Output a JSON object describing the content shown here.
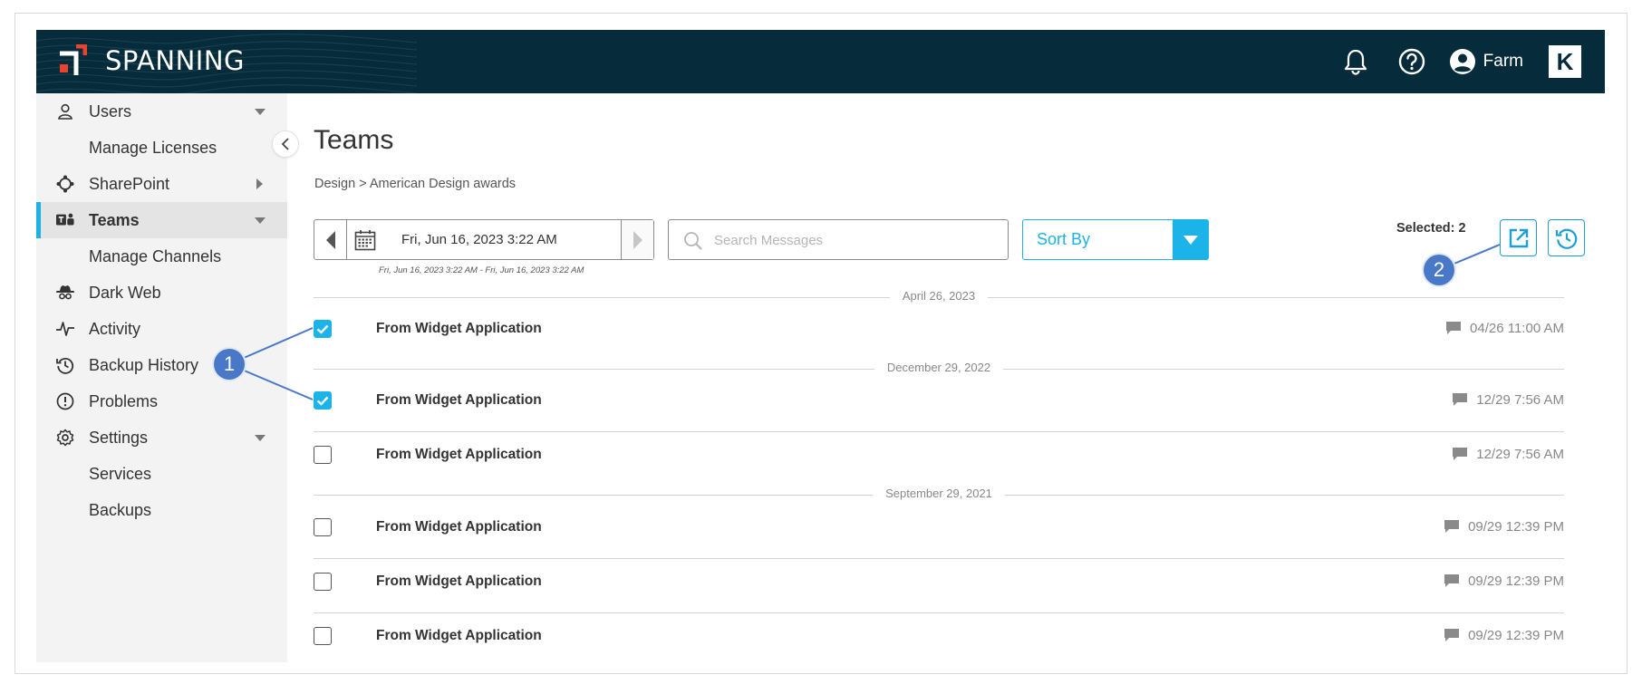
{
  "header": {
    "brand": "SPANNING",
    "user_name": "Farm",
    "k_logo": "K"
  },
  "sidebar": {
    "items": [
      {
        "label": "Users",
        "icon": "user-icon",
        "caret": "down"
      },
      {
        "label": "Manage Licenses"
      },
      {
        "label": "SharePoint",
        "icon": "sharepoint-icon",
        "caret": "right"
      },
      {
        "label": "Teams",
        "icon": "teams-icon",
        "caret": "down",
        "active": true
      },
      {
        "label": "Manage Channels"
      },
      {
        "label": "Dark Web",
        "icon": "spy-icon"
      },
      {
        "label": "Activity",
        "icon": "activity-icon"
      },
      {
        "label": "Backup History",
        "icon": "history-icon"
      },
      {
        "label": "Problems",
        "icon": "alert-icon"
      },
      {
        "label": "Settings",
        "icon": "gear-icon",
        "caret": "down"
      },
      {
        "label": "Services"
      },
      {
        "label": "Backups"
      }
    ]
  },
  "main": {
    "title": "Teams",
    "breadcrumb": "Design > American Design awards",
    "date_picker": {
      "value": "Fri, Jun 16, 2023 3:22 AM",
      "range": "Fri, Jun 16, 2023 3:22 AM - Fri, Jun 16, 2023 3:22 AM"
    },
    "search": {
      "placeholder": "Search Messages",
      "value": ""
    },
    "sort_by": "Sort By",
    "selected": "Selected: 2",
    "groups": [
      {
        "date": "April 26, 2023",
        "rows": [
          {
            "title": "From Widget Application",
            "time": "04/26 11:00 AM",
            "checked": true
          }
        ]
      },
      {
        "date": "December 29, 2022",
        "rows": [
          {
            "title": "From Widget Application",
            "time": "12/29 7:56 AM",
            "checked": true
          },
          {
            "title": "From Widget Application",
            "time": "12/29 7:56 AM",
            "checked": false
          }
        ]
      },
      {
        "date": "September 29, 2021",
        "rows": [
          {
            "title": "From Widget Application",
            "time": "09/29 12:39 PM",
            "checked": false
          },
          {
            "title": "From Widget Application",
            "time": "09/29 12:39 PM",
            "checked": false
          },
          {
            "title": "From Widget Application",
            "time": "09/29 12:39 PM",
            "checked": false
          }
        ]
      }
    ]
  },
  "callouts": {
    "one": "1",
    "two": "2"
  },
  "colors": {
    "accent": "#1bb3e8",
    "header_bg": "#062b3a",
    "callout": "#4a78c8",
    "logo_red": "#e8432e"
  }
}
